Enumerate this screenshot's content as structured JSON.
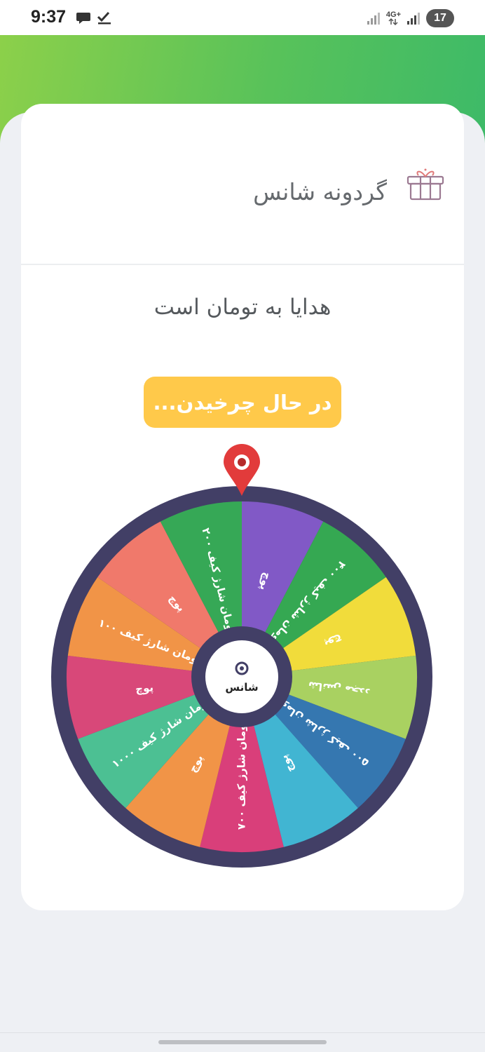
{
  "status_bar": {
    "time": "9:37",
    "network": "4G+",
    "battery": "17",
    "icons": [
      "chat-bubble-icon",
      "check-icon",
      "signal-icon",
      "signal-icon"
    ]
  },
  "card": {
    "title": "گردونه شانس",
    "title_icon": "gift-icon",
    "subtitle": "هدایا به تومان است",
    "spin_button_label": "در حال چرخیدن..."
  },
  "wheel": {
    "center_label": "شانس",
    "pointer_icon": "map-pin-icon",
    "segments": [
      {
        "label": "پوچ",
        "color": "#8159c6"
      },
      {
        "label": "۴۰۰ تومان شارژ کیف",
        "color": "#35a852"
      },
      {
        "label": "پوچ",
        "color": "#f1dc3b"
      },
      {
        "label": "شانس مجدد",
        "color": "#a9d161"
      },
      {
        "label": "۵۰۰ تومان شارژ کیف",
        "color": "#3577b0"
      },
      {
        "label": "پوچ",
        "color": "#41b5d2"
      },
      {
        "label": "۷۰۰ تومان شارژ کیف",
        "color": "#d93f7a"
      },
      {
        "label": "پوچ",
        "color": "#f19447"
      },
      {
        "label": "۱۰۰۰ تومان شارژ کیف",
        "color": "#4cc093"
      },
      {
        "label": "پوچ",
        "color": "#d84879"
      },
      {
        "label": "۱۰۰ تومان شارژ کیف",
        "color": "#f19447"
      },
      {
        "label": "پوچ",
        "color": "#f0796b"
      },
      {
        "label": "۲۰۰ تومان شارژ کیف",
        "color": "#36a856"
      }
    ],
    "rim_color": "#423f66",
    "pointer_color": "#e23b3b",
    "button_color": "#ffc94a",
    "accent_color": "#4cbf5e"
  }
}
